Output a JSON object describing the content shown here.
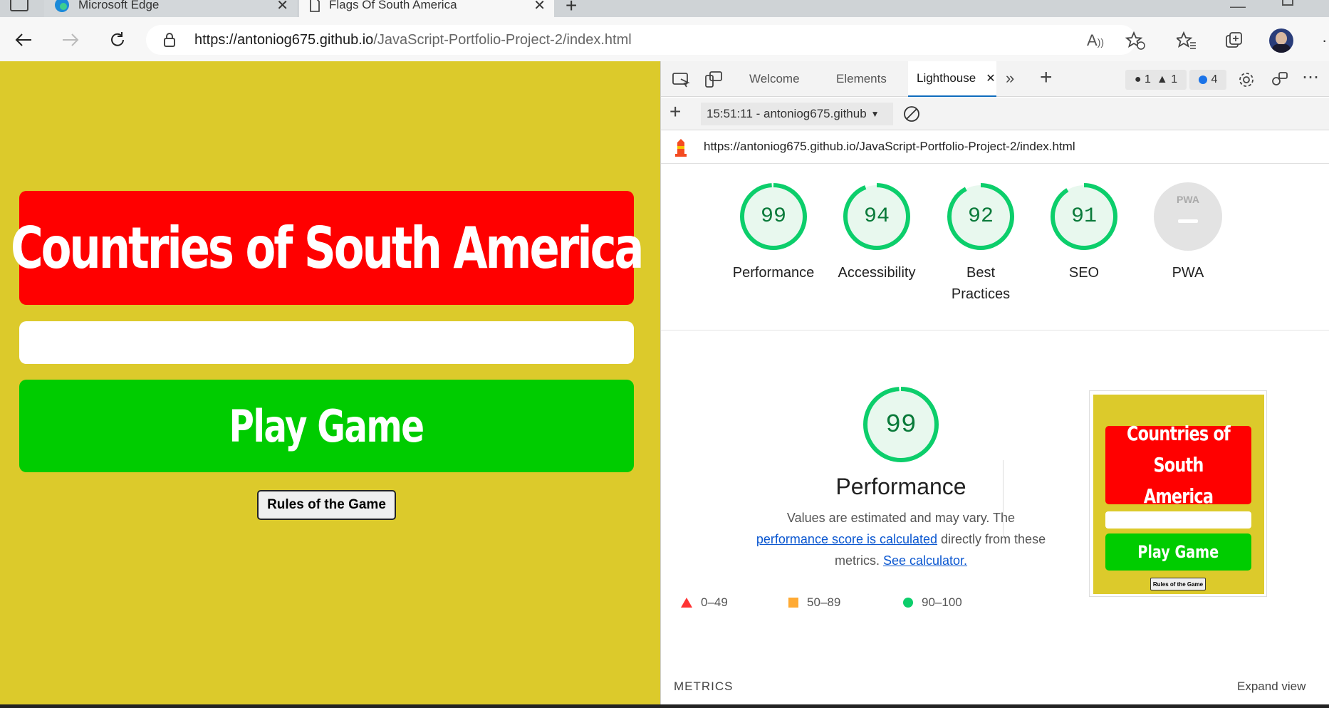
{
  "browser": {
    "tabs": [
      {
        "label": "Microsoft Edge",
        "icon": "edge-logo-icon"
      },
      {
        "label": "Flags Of South America",
        "icon": "page-icon"
      }
    ],
    "address": {
      "host": "https://antoniog675.github.io",
      "path": "/JavaScript-Portfolio-Project-2/index.html"
    }
  },
  "page": {
    "title": "Countries of South America",
    "play_button": "Play Game",
    "rules_button": "Rules of the Game",
    "colors": {
      "background": "#dcca2b",
      "title": "#ff0000",
      "play": "#00cc00"
    }
  },
  "devtools": {
    "tabs": [
      "Welcome",
      "Elements",
      "Lighthouse"
    ],
    "badges": {
      "errors": "1",
      "warnings": "1",
      "issues": "4"
    },
    "report_select": "15:51:11 - antoniog675.github",
    "report_url": "https://antoniog675.github.io/JavaScript-Portfolio-Project-2/index.html",
    "scores": [
      {
        "value": "99",
        "label": "Performance"
      },
      {
        "value": "94",
        "label": "Accessibility"
      },
      {
        "value": "92",
        "label": "Best Practices"
      },
      {
        "value": "91",
        "label": "SEO"
      },
      {
        "value": "",
        "label": "PWA"
      }
    ],
    "pwa_badge": "PWA",
    "performance": {
      "score": "99",
      "label": "Performance",
      "desc_before": "Values are estimated and may vary. The ",
      "desc_link1": "performance score is calculated",
      "desc_middle": " directly from these metrics. ",
      "desc_link2": "See calculator."
    },
    "legend": [
      "0–49",
      "50–89",
      "90–100"
    ],
    "thumbnail": {
      "title": "Countries of South America",
      "play": "Play Game",
      "rules": "Rules of the Game"
    },
    "metrics_label": "METRICS",
    "expand_view": "Expand view"
  }
}
